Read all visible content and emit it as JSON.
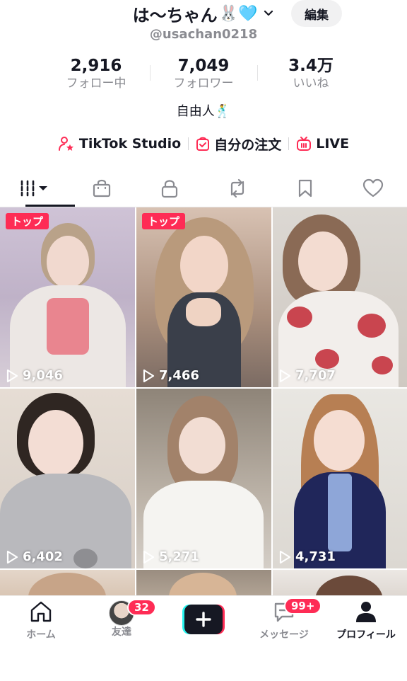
{
  "profile": {
    "display_name": "は〜ちゃん",
    "name_emoji": "🐰🩵",
    "username": "@usachan0218",
    "edit_label": "編集",
    "bio": "自由人🕺"
  },
  "stats": [
    {
      "value": "2,916",
      "label": "フォロー中"
    },
    {
      "value": "7,049",
      "label": "フォロワー"
    },
    {
      "value": "3.4万",
      "label": "いいね"
    }
  ],
  "links": [
    {
      "label": "TikTok Studio",
      "icon": "person-star-icon"
    },
    {
      "label": "自分の注文",
      "icon": "order-bag-icon"
    },
    {
      "label": "LIVE",
      "icon": "live-tv-icon"
    }
  ],
  "tabs": [
    "videos-grid-icon",
    "shop-bag-icon",
    "lock-icon",
    "repost-icon",
    "bookmark-icon",
    "heart-icon"
  ],
  "videos": [
    {
      "badge": "トップ",
      "views": "9,046"
    },
    {
      "badge": "トップ",
      "views": "7,466"
    },
    {
      "badge": "",
      "views": "7,707"
    },
    {
      "badge": "",
      "views": "6,402"
    },
    {
      "badge": "",
      "views": "5,271"
    },
    {
      "badge": "",
      "views": "4,731"
    }
  ],
  "nav": {
    "home": "ホーム",
    "friends": "友達",
    "friends_badge": "32",
    "messages": "メッセージ",
    "messages_badge": "99+",
    "profile": "プロフィール"
  },
  "colors": {
    "accent": "#fe2c55",
    "text": "#161823",
    "muted": "#8a8b91"
  }
}
